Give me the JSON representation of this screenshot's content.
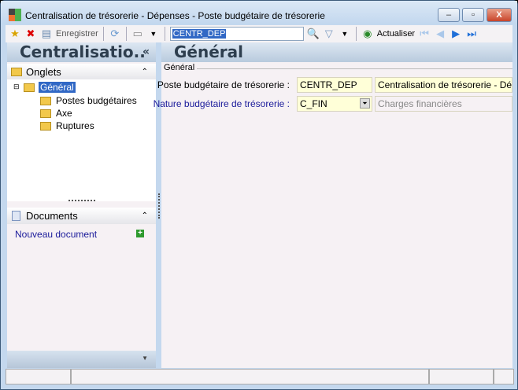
{
  "window": {
    "title": "Centralisation de trésorerie - Dépenses -  Poste budgétaire de trésorerie",
    "minimize": "‒",
    "maximize": "▫",
    "close": "X"
  },
  "toolbar": {
    "save_label": "Enregistrer",
    "search_value": "CENTR_DEP",
    "refresh_label": "Actualiser"
  },
  "left": {
    "title": "Centralisatio..",
    "collapse": "«",
    "tabs_header": "Onglets",
    "tree": [
      "Général",
      "Postes budgétaires",
      "Axe",
      "Ruptures"
    ],
    "docs_header": "Documents",
    "new_doc": "Nouveau document"
  },
  "main": {
    "title": "Général",
    "group": "Général",
    "rows": [
      {
        "label": "Poste budgétaire de trésorerie :",
        "code": "CENTR_DEP",
        "desc": "Centralisation de trésorerie - Dépenses"
      },
      {
        "label": "Nature budgétaire de trésorerie :",
        "code": "C_FIN",
        "desc": "Charges financières"
      }
    ]
  }
}
